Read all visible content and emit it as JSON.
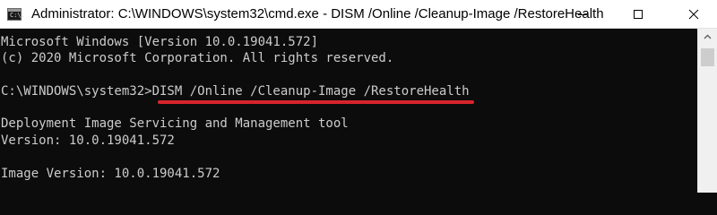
{
  "window": {
    "title": "Administrator: C:\\WINDOWS\\system32\\cmd.exe - DISM  /Online /Cleanup-Image /RestoreHealth",
    "icon": "console-app-icon",
    "icon_glyph": "C:\\."
  },
  "console": {
    "lines": [
      "Microsoft Windows [Version 10.0.19041.572]",
      "(c) 2020 Microsoft Corporation. All rights reserved.",
      "",
      "C:\\WINDOWS\\system32>DISM /Online /Cleanup-Image /RestoreHealth",
      "",
      "Deployment Image Servicing and Management tool",
      "Version: 10.0.19041.572",
      "",
      "Image Version: 10.0.19041.572"
    ],
    "text_color": "#cccccc",
    "background_color": "#0c0c0c",
    "highlight_color": "#d9242c"
  }
}
